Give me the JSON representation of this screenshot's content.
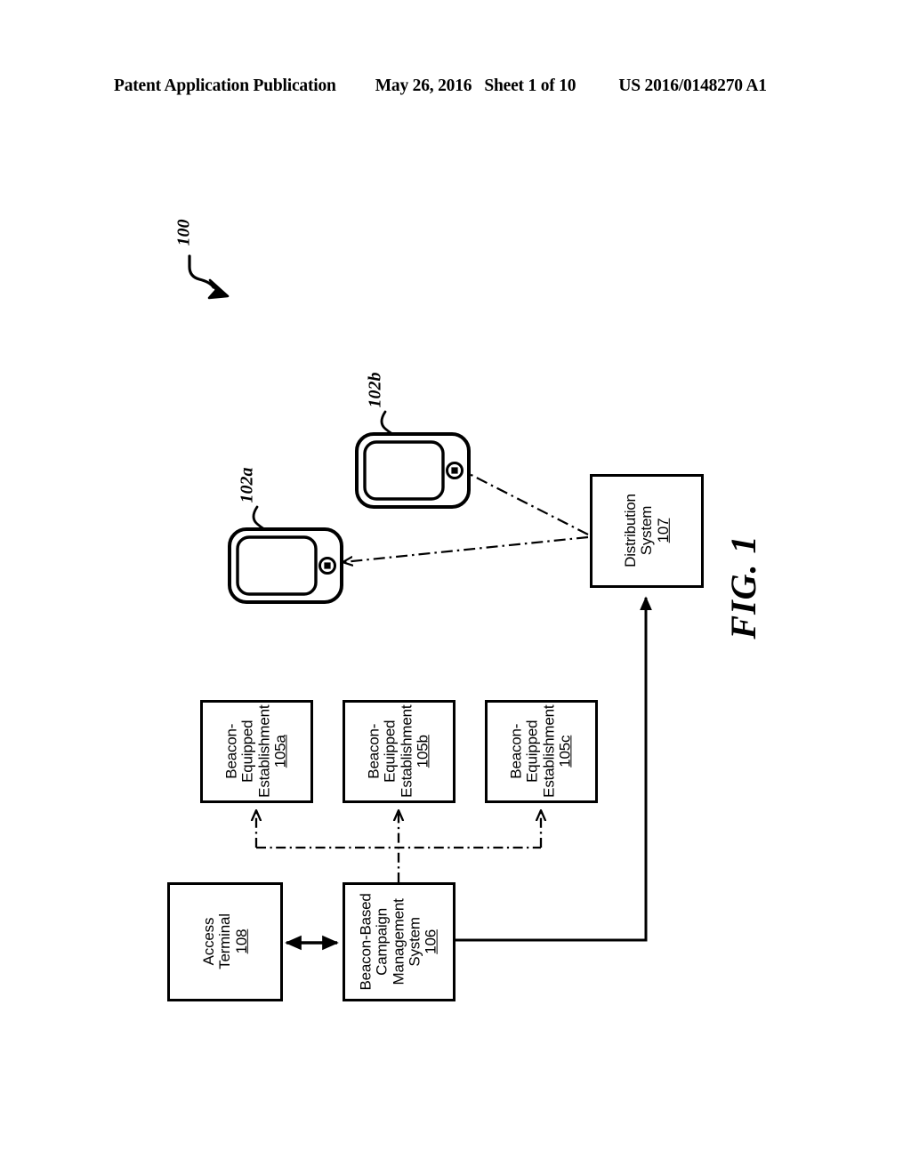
{
  "header": {
    "publication": "Patent Application Publication",
    "date": "May 26, 2016",
    "sheet": "Sheet 1 of 10",
    "patent_number": "US 2016/0148270 A1"
  },
  "figure": {
    "label": "FIG. 1",
    "system_numeral": "100",
    "devices": [
      {
        "id": "102a",
        "numeral": "102a",
        "name": "mobile-device-102a"
      },
      {
        "id": "102b",
        "numeral": "102b",
        "name": "mobile-device-102b"
      }
    ],
    "boxes": [
      {
        "id": "distribution-system",
        "lines": [
          "Distribution",
          "System"
        ],
        "numeral": "107"
      },
      {
        "id": "establishment-a",
        "lines": [
          "Beacon-",
          "Equipped",
          "Establishment"
        ],
        "numeral": "105a"
      },
      {
        "id": "establishment-b",
        "lines": [
          "Beacon-",
          "Equipped",
          "Establishment"
        ],
        "numeral": "105b"
      },
      {
        "id": "establishment-c",
        "lines": [
          "Beacon-",
          "Equipped",
          "Establishment"
        ],
        "numeral": "105c"
      },
      {
        "id": "campaign-management-system",
        "lines": [
          "Beacon-Based",
          "Campaign",
          "Management",
          "System"
        ],
        "numeral": "106"
      },
      {
        "id": "access-terminal",
        "lines": [
          "Access",
          "Terminal"
        ],
        "numeral": "108"
      }
    ]
  },
  "colors": {
    "ink": "#000000",
    "paper": "#ffffff"
  }
}
